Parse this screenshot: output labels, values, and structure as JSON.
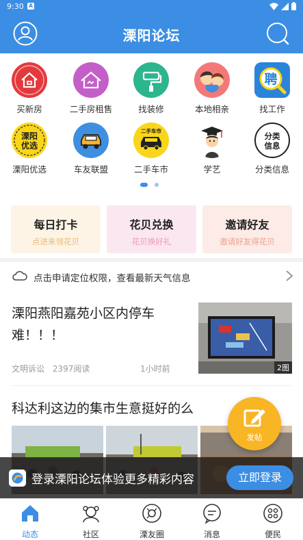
{
  "status": {
    "time": "9:30",
    "notif": "A"
  },
  "header": {
    "title": "溧阳论坛"
  },
  "categories": [
    {
      "label": "买新房",
      "icon": "new-house-icon",
      "color": "#e4393c"
    },
    {
      "label": "二手房租售",
      "icon": "second-hand-house-icon",
      "color": "#c45ec8"
    },
    {
      "label": "找装修",
      "icon": "paint-roller-icon",
      "color": "#2db68d"
    },
    {
      "label": "本地相亲",
      "icon": "dating-couple-icon",
      "color": "#f37878"
    },
    {
      "label": "找工作",
      "icon": "job-recruit-icon",
      "color": "#2a84d9",
      "badge_text": "聘"
    },
    {
      "label": "溧阳优选",
      "icon": "liyang-select-icon",
      "color": "#f9d61a",
      "badge_text": "溧阳优选"
    },
    {
      "label": "车友联盟",
      "icon": "car-club-icon",
      "color": "#3f8fe0"
    },
    {
      "label": "二手车市",
      "icon": "used-car-icon",
      "color": "#f9d61a",
      "badge_text": "二手车市"
    },
    {
      "label": "学艺",
      "icon": "graduate-icon",
      "color": "#ffffff"
    },
    {
      "label": "分类信息",
      "icon": "classified-info-icon",
      "color": "#f2f2f2",
      "badge_text": "分类信息"
    }
  ],
  "pager": {
    "pages": 2,
    "active": 0
  },
  "cards": [
    {
      "title": "每日打卡",
      "subtitle": "点进来领花贝",
      "bg": "#fdf4e6",
      "sub_color": "#e9b878"
    },
    {
      "title": "花贝兑换",
      "subtitle": "花贝换好礼",
      "bg": "#fbe7ef",
      "sub_color": "#e89ab8"
    },
    {
      "title": "邀请好友",
      "subtitle": "邀请好友得花贝",
      "bg": "#fcebe6",
      "sub_color": "#ef9e8a"
    }
  ],
  "weather": {
    "text": "点击申请定位权限，查看最新天气信息"
  },
  "posts": [
    {
      "title": "溧阳燕阳嘉苑小区内停车难！！！",
      "author": "文明诉讼",
      "views": "2397阅读",
      "time": "1小时前",
      "image_count": "2图"
    },
    {
      "title": "科达利这边的集市生意挺好的么"
    }
  ],
  "fab": {
    "label": "发帖"
  },
  "login_bar": {
    "text": "登录溧阳论坛体验更多精彩内容",
    "button": "立即登录"
  },
  "tabs": [
    {
      "label": "动态",
      "icon": "home-icon",
      "active": true
    },
    {
      "label": "社区",
      "icon": "community-icon",
      "active": false
    },
    {
      "label": "溧友圈",
      "icon": "friends-circle-icon",
      "active": false
    },
    {
      "label": "消息",
      "icon": "message-icon",
      "active": false
    },
    {
      "label": "便民",
      "icon": "services-icon",
      "active": false
    }
  ],
  "colors": {
    "brand": "#3b8ee3",
    "fab": "#f8b524"
  }
}
